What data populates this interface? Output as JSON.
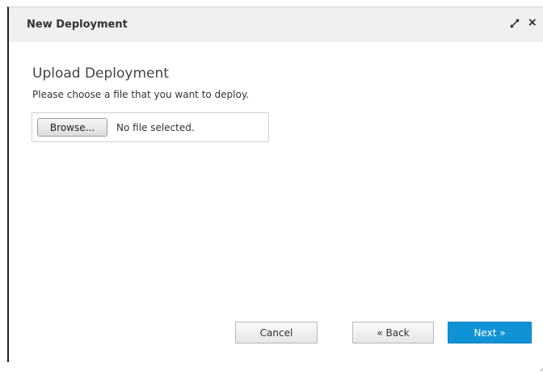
{
  "dialog": {
    "title": "New Deployment",
    "maximize_icon": "expand-arrows-icon",
    "close_icon": "close-icon",
    "close_glyph": "×"
  },
  "upload": {
    "heading": "Upload Deployment",
    "instruction": "Please choose a file that you want to deploy.",
    "browse_label": "Browse...",
    "file_status": "No file selected."
  },
  "footer": {
    "cancel_label": "Cancel",
    "back_label": "« Back",
    "next_label": "Next »"
  },
  "colors": {
    "primary": "#0f93d6",
    "titlebar": "#f0f0f0"
  }
}
